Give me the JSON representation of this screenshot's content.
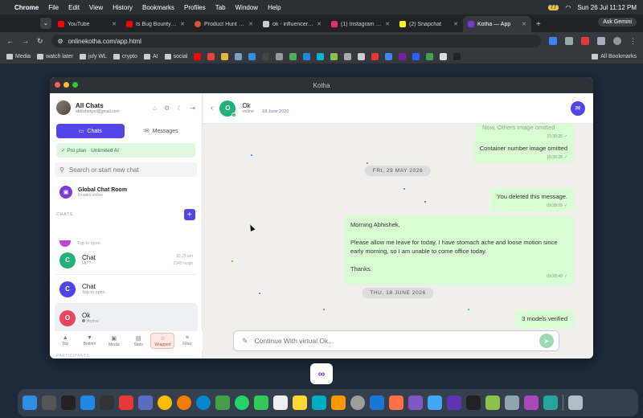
{
  "menubar": {
    "app": "Chrome",
    "items": [
      "File",
      "Edit",
      "View",
      "History",
      "Bookmarks",
      "Profiles",
      "Tab",
      "Window",
      "Help"
    ],
    "battery": "77",
    "clock": "Sun 26 Jul  11:12 PM"
  },
  "browser": {
    "tabs": [
      {
        "label": "YouTube",
        "color": "#ff0000"
      },
      {
        "label": "Is Bug Bounty Re",
        "color": "#ff0000"
      },
      {
        "label": "Product Hunt – T",
        "color": "#da552f"
      },
      {
        "label": "ok - influencer Cl",
        "color": "#cccccc"
      },
      {
        "label": "(1) Instagram • M",
        "color": "#e1306c"
      },
      {
        "label": "(2) Snapchat",
        "color": "#fffc00"
      },
      {
        "label": "Kotha — App",
        "color": "#6f3dd3"
      }
    ],
    "new_tab": "+",
    "ask_gemini": "Ask Gemini",
    "url": "onlinekotha.com/app.html",
    "bookmarks": [
      "Media",
      "watch later",
      "july WL",
      "crypto",
      "AI",
      "social"
    ],
    "all_bookmarks": "All Bookmarks"
  },
  "window": {
    "title": "Kotha"
  },
  "sidebar": {
    "user_name": "All Chats",
    "user_email": "abhishekpal@gmail.com",
    "seg_chats": "Chats",
    "seg_messages": "Messages",
    "pro": "✓ Pro plan · Unlimited AI",
    "search_placeholder": "Search or start new chat",
    "global_title": "Global Chat Room",
    "global_sub": "0 users online",
    "chats_label": "CHATS",
    "plus": "+",
    "partial_sub": "Tap to open",
    "chats": [
      {
        "initial": "C",
        "name": "Chat",
        "sub": "Hi??",
        "time": "10:29 am",
        "meta2": "2349 msgs",
        "color": "#22b07d"
      },
      {
        "initial": "C",
        "name": "Chat",
        "sub": "Tap to open",
        "time": "",
        "meta2": "",
        "color": "#5145e5"
      },
      {
        "initial": "O",
        "name": "Ok",
        "sub": "Active",
        "time": "",
        "meta2": "",
        "color": "#e8435f"
      }
    ],
    "bottom_nav": [
      {
        "icon": "▲",
        "label": "Top"
      },
      {
        "icon": "▼",
        "label": "Bottom"
      },
      {
        "icon": "▣",
        "label": "Media"
      },
      {
        "icon": "▤",
        "label": "Stats"
      },
      {
        "icon": "☆",
        "label": "Wrapped"
      },
      {
        "icon": "≡",
        "label": "Filter"
      }
    ],
    "participants": "PARTICIPANTS"
  },
  "chat": {
    "name": "Ok",
    "status": "online",
    "date": "18 June 2026",
    "messages": [
      {
        "text": "Now, Others image omitted",
        "time": "15:39:28"
      },
      {
        "text": "Container number image omitted",
        "time": "15:39:28"
      },
      {
        "text": "You deleted this message.",
        "time": "09:28:09"
      },
      {
        "text": "Morning Abhishek,",
        "time": ""
      },
      {
        "text": "Please allow me leave for today. I have stomach ache and loose motion since early morning, so I am unable to come office today.",
        "time": ""
      },
      {
        "text": "Thanks.",
        "time": "09:28:49"
      },
      {
        "text": "3 models verified",
        "time": ""
      }
    ],
    "separators": [
      "FRI, 29 MAY 2026",
      "THU, 18 JUNE 2026"
    ],
    "composer_placeholder": "Continue With virtual Ok...",
    "check": "✓"
  },
  "dock": {
    "app_badge": "∞"
  }
}
